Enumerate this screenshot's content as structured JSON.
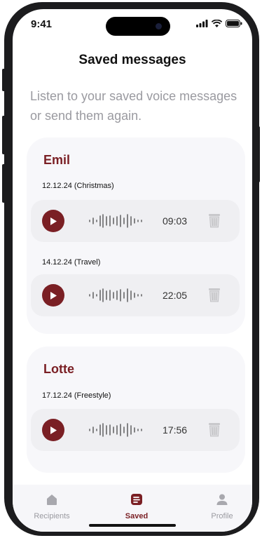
{
  "status": {
    "time": "9:41"
  },
  "header": {
    "title": "Saved messages",
    "subtitle": "Listen to your saved voice messages or send them again."
  },
  "recipients": [
    {
      "name": "Emil",
      "messages": [
        {
          "date": "12.12.24 (Christmas)",
          "duration": "09:03"
        },
        {
          "date": "14.12.24 (Travel)",
          "duration": "22:05"
        }
      ]
    },
    {
      "name": "Lotte",
      "messages": [
        {
          "date": "17.12.24 (Freestyle)",
          "duration": "17:56"
        }
      ]
    }
  ],
  "tabbar": {
    "tabs": [
      {
        "label": "Recipients",
        "icon": "home-icon",
        "active": false
      },
      {
        "label": "Saved",
        "icon": "saved-list-icon",
        "active": true
      },
      {
        "label": "Profile",
        "icon": "person-icon",
        "active": false
      }
    ]
  },
  "colors": {
    "accent": "#7a1f24",
    "muted": "#9a9aa0",
    "card": "#f7f7fa",
    "row": "#efeff2"
  }
}
